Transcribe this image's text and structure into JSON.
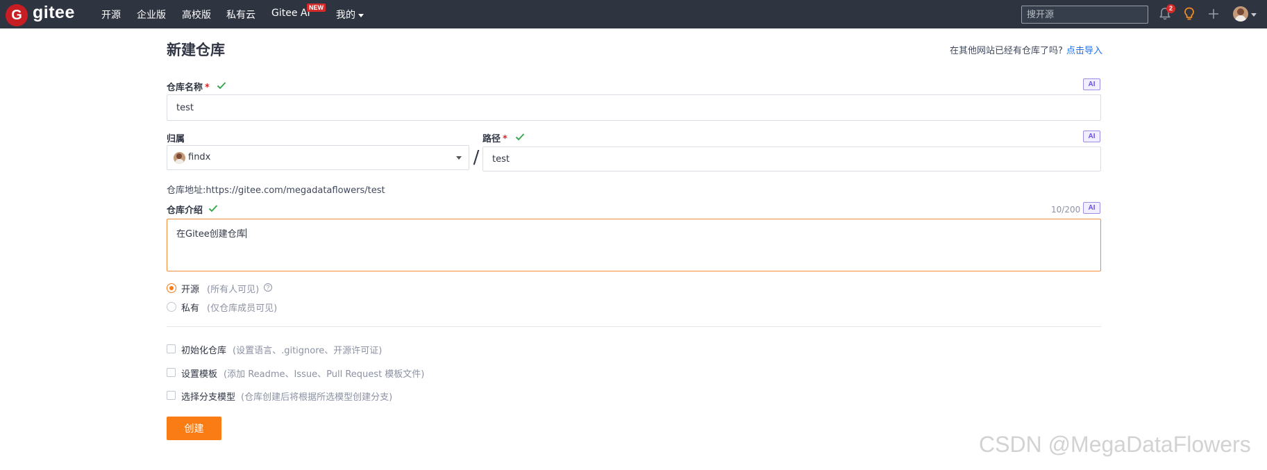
{
  "topbar": {
    "logo_text": "gitee",
    "nav": [
      "开源",
      "企业版",
      "高校版",
      "私有云",
      "Gitee AI",
      "我的"
    ],
    "ai_badge": "NEW",
    "search_placeholder": "搜开源",
    "notification_count": "2",
    "icons": [
      "bell-icon",
      "lightbulb-icon",
      "plus-icon",
      "avatar"
    ]
  },
  "page": {
    "title": "新建仓库",
    "import_prompt": "在其他网站已经有仓库了吗?",
    "import_link": "点击导入"
  },
  "form": {
    "name_label": "仓库名称",
    "required_mark": "*",
    "name_value": "test",
    "ai_label": "AI",
    "owner_label": "归属",
    "owner_value": "findx",
    "path_label": "路径",
    "path_value": "test",
    "separator": "/",
    "repo_address_label": "仓库地址:",
    "repo_address_value": "https://gitee.com/megadataflowers/test",
    "desc_label": "仓库介绍",
    "desc_counter": "10/200",
    "desc_value": "在Gitee创建仓库",
    "visibility": [
      {
        "label": "开源",
        "hint": "(所有人可见)",
        "selected": true
      },
      {
        "label": "私有",
        "hint": "(仅仓库成员可见)",
        "selected": false
      }
    ],
    "options": [
      {
        "label": "初始化仓库",
        "hint": "(设置语言、.gitignore、开源许可证)",
        "checked": false
      },
      {
        "label": "设置模板",
        "hint": "(添加 Readme、Issue、Pull Request 模板文件)",
        "checked": false
      },
      {
        "label": "选择分支模型",
        "hint": "(仓库创建后将根据所选模型创建分支)",
        "checked": false
      }
    ],
    "submit_label": "创建"
  },
  "colors": {
    "topbar_bg": "#2e3440",
    "accent": "#fa7c15",
    "link": "#1f6feb",
    "success_check": "#39a84f",
    "required": "#d72a2a"
  },
  "watermark": "CSDN @MegaDataFlowers"
}
